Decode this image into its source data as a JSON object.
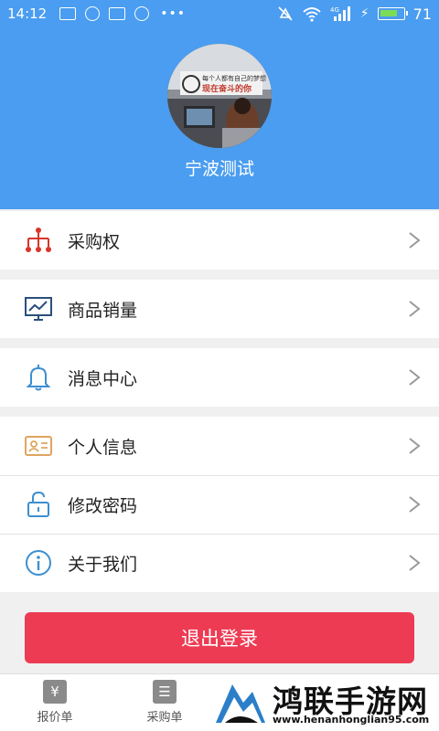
{
  "status_bar": {
    "time": "14:12",
    "battery": "71",
    "network_label": "4G"
  },
  "profile": {
    "username": "宁波测试",
    "avatar_caption_line1": "每个人都有自己的梦想",
    "avatar_caption_line2": "现在奋斗的你"
  },
  "menu": {
    "group1": [
      {
        "label": "采购权",
        "icon": "org-chart-icon"
      }
    ],
    "group2": [
      {
        "label": "商品销量",
        "icon": "monitor-chart-icon"
      }
    ],
    "group3": [
      {
        "label": "消息中心",
        "icon": "bell-icon"
      }
    ],
    "group4": [
      {
        "label": "个人信息",
        "icon": "id-card-icon"
      },
      {
        "label": "修改密码",
        "icon": "unlock-icon"
      },
      {
        "label": "关于我们",
        "icon": "info-icon"
      }
    ]
  },
  "logout_label": "退出登录",
  "tabs": [
    {
      "label": "报价单",
      "icon": "yen-doc-icon",
      "glyph": "¥"
    },
    {
      "label": "采购单",
      "icon": "checklist-icon",
      "glyph": "☰"
    }
  ],
  "watermark": {
    "title": "鸿联手游网",
    "url": "www.henanhonglian95.com"
  },
  "colors": {
    "header_blue": "#4a9df0",
    "logout_red": "#ee3b54",
    "icon_red": "#d9342b",
    "icon_navy": "#2b4f7a",
    "icon_blue": "#3c8fd0",
    "icon_orange": "#e0a560"
  }
}
